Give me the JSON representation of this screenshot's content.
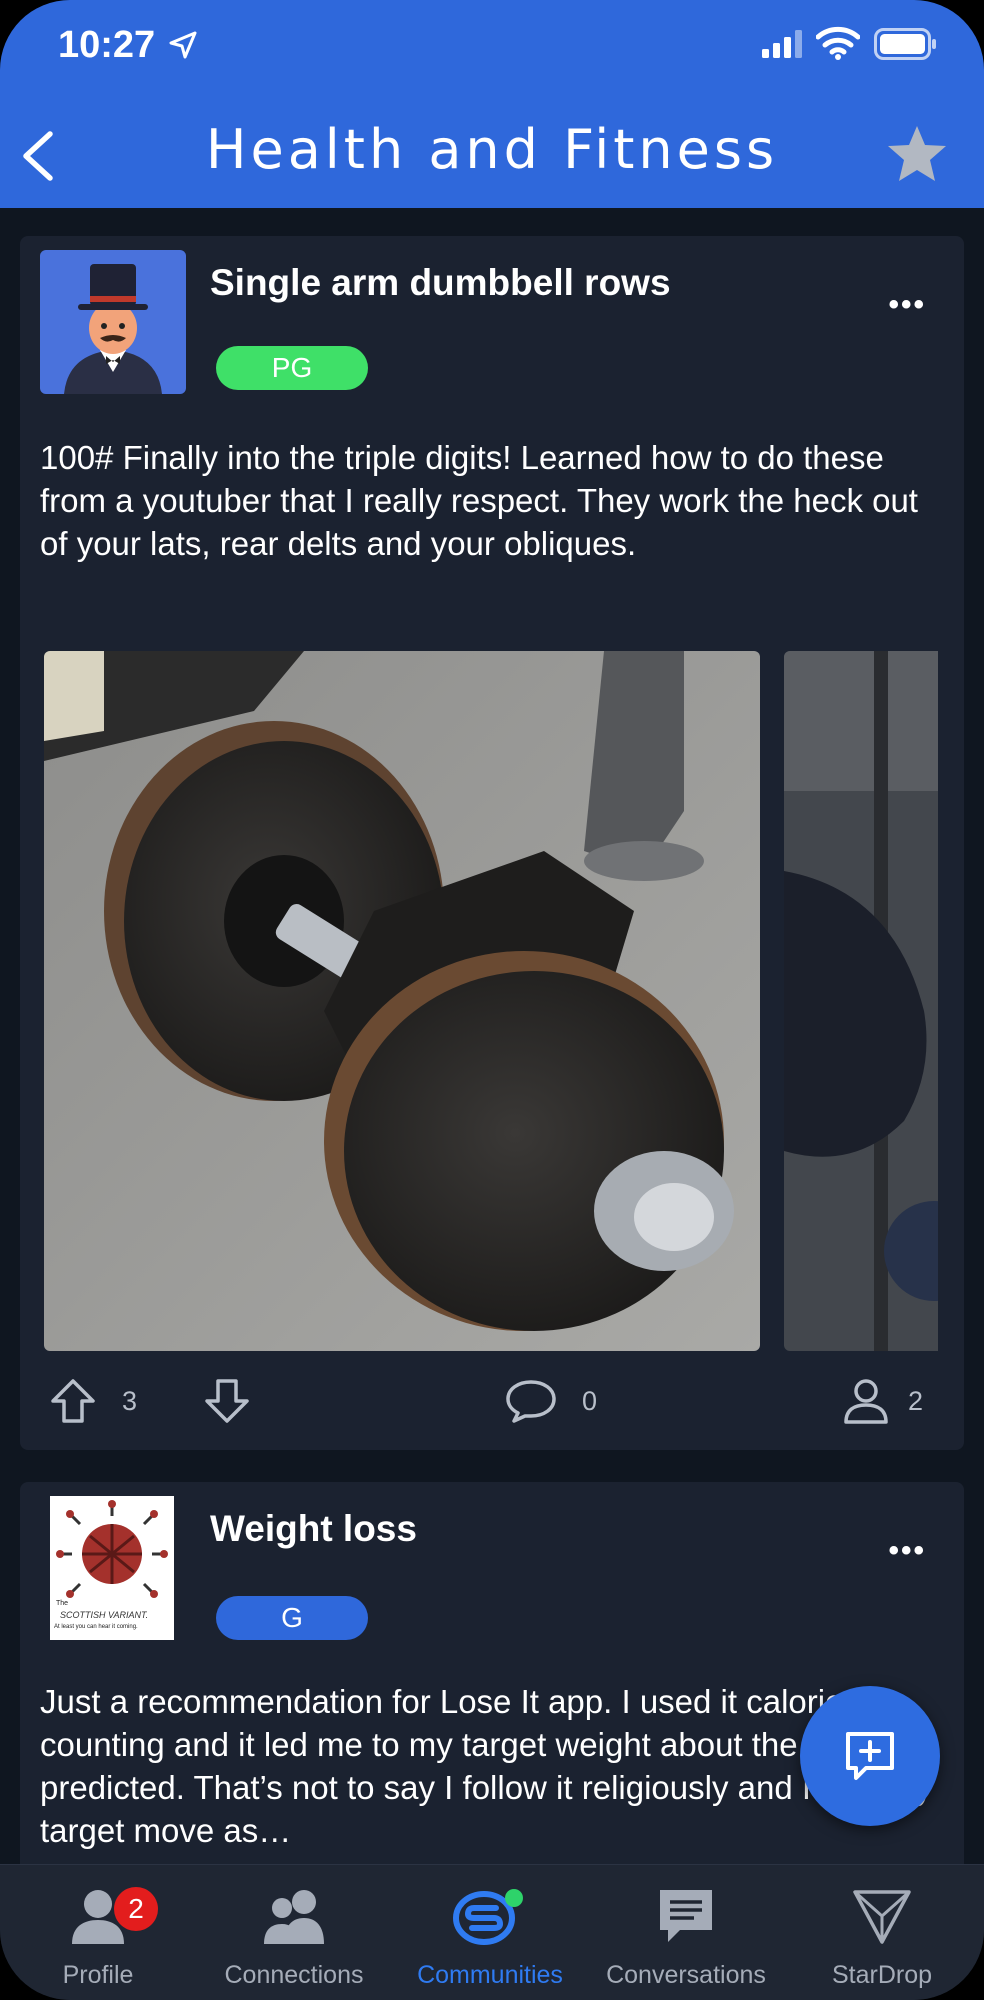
{
  "status_bar": {
    "time": "10:27"
  },
  "header": {
    "title": "Health and Fitness"
  },
  "posts": [
    {
      "title": "Single arm dumbbell rows",
      "rating": "PG",
      "rating_color": "#3fe068",
      "body": "100# Finally into the triple digits!  Learned how to do these from a youtuber that I really respect.  They work the heck out of your lats, rear delts and your obliques.",
      "upvotes": "3",
      "comments": "0",
      "participants": "2"
    },
    {
      "title": "Weight loss",
      "rating": "G",
      "rating_color": "#2f68db",
      "body": "Just a recommendation for Lose It app. I used it calorie counting and it led me to my target weight about the time it predicted. That’s not to say I follow it religiously and I saw my target move as…",
      "avatar_caption_1": "The",
      "avatar_caption_2": "SCOTTISH VARIANT.",
      "avatar_caption_3": "At least you can hear it coming."
    }
  ],
  "nav": {
    "profile": "Profile",
    "profile_badge": "2",
    "connections": "Connections",
    "communities": "Communities",
    "conversations": "Conversations",
    "stardrop": "StarDrop"
  },
  "colors": {
    "header": "#2f68db",
    "card": "#1b2230",
    "accent": "#2f7bf2"
  }
}
